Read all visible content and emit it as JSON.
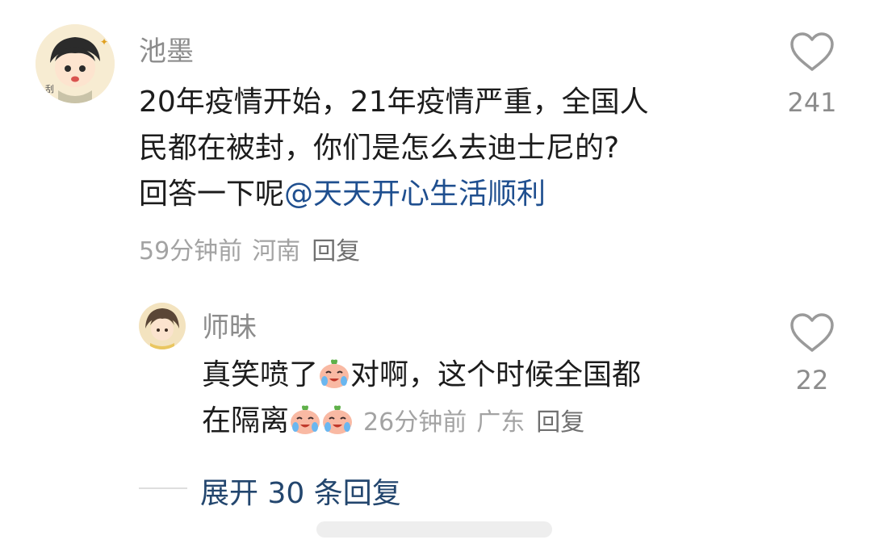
{
  "comment": {
    "username": "池墨",
    "text_lines": [
      "20年疫情开始，21年疫情严重，全国人",
      "民都在被封，你们是怎么去迪士尼的?"
    ],
    "line3_prefix": "回答一下呢",
    "mention": "@天天开心生活顺利",
    "time": "59分钟前",
    "location": "河南",
    "reply_label": "回复",
    "like_count": "241",
    "like_icon": "heart-outline-icon"
  },
  "reply": {
    "username": "师昧",
    "text_a": "真笑喷了",
    "text_b": "对啊，这个时候全国都",
    "text_c": "在隔离",
    "emoji_icon": "crying-laughing-peach-emoji",
    "time": "26分钟前",
    "location": "广东",
    "reply_label": "回复",
    "like_count": "22",
    "like_icon": "heart-outline-icon"
  },
  "expand_label": "展开 30 条回复",
  "colors": {
    "mention": "#1f4f8f",
    "expand": "#23466e",
    "meta": "#a3a3a3",
    "username": "#8c8c8c"
  }
}
